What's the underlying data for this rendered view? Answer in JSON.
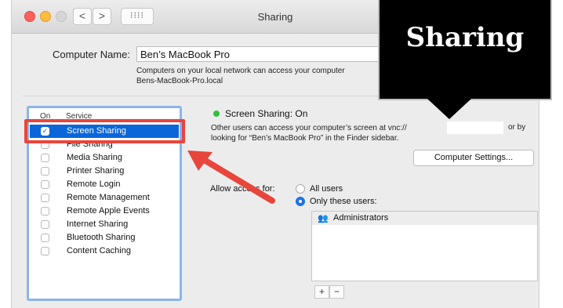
{
  "window": {
    "title": "Sharing",
    "nav": {
      "back": "<",
      "forward": ">",
      "grid": "⁝⁝⁝⁝"
    }
  },
  "computer_name": {
    "label": "Computer Name:",
    "value": "Ben’s MacBook Pro",
    "note_line1": "Computers on your local network can access your computer",
    "note_line2": "Bens-MacBook-Pro.local"
  },
  "services": {
    "header_on": "On",
    "header_service": "Service",
    "items": [
      {
        "label": "Screen Sharing",
        "checked": true,
        "selected": true
      },
      {
        "label": "File Sharing",
        "checked": false
      },
      {
        "label": "Media Sharing",
        "checked": false
      },
      {
        "label": "Printer Sharing",
        "checked": false
      },
      {
        "label": "Remote Login",
        "checked": false
      },
      {
        "label": "Remote Management",
        "checked": false
      },
      {
        "label": "Remote Apple Events",
        "checked": false
      },
      {
        "label": "Internet Sharing",
        "checked": false
      },
      {
        "label": "Bluetooth Sharing",
        "checked": false
      },
      {
        "label": "Content Caching",
        "checked": false
      }
    ]
  },
  "detail": {
    "status": "Screen Sharing: On",
    "desc_line1": "Other users can access your computer’s screen at vnc://",
    "desc_line1_end": "or by",
    "desc_line2": "looking for “Ben’s MacBook Pro” in the Finder sidebar.",
    "computer_settings_button": "Computer Settings...",
    "allow_access_label": "Allow access for:",
    "radio_all": "All users",
    "radio_only": "Only these users:",
    "users": [
      "Administrators"
    ],
    "add_button": "+",
    "remove_button": "−"
  },
  "callout": {
    "text": "Sharing"
  },
  "colors": {
    "selection": "#0b67d9",
    "highlight": "#e8453c",
    "status_on": "#2ec23b"
  }
}
